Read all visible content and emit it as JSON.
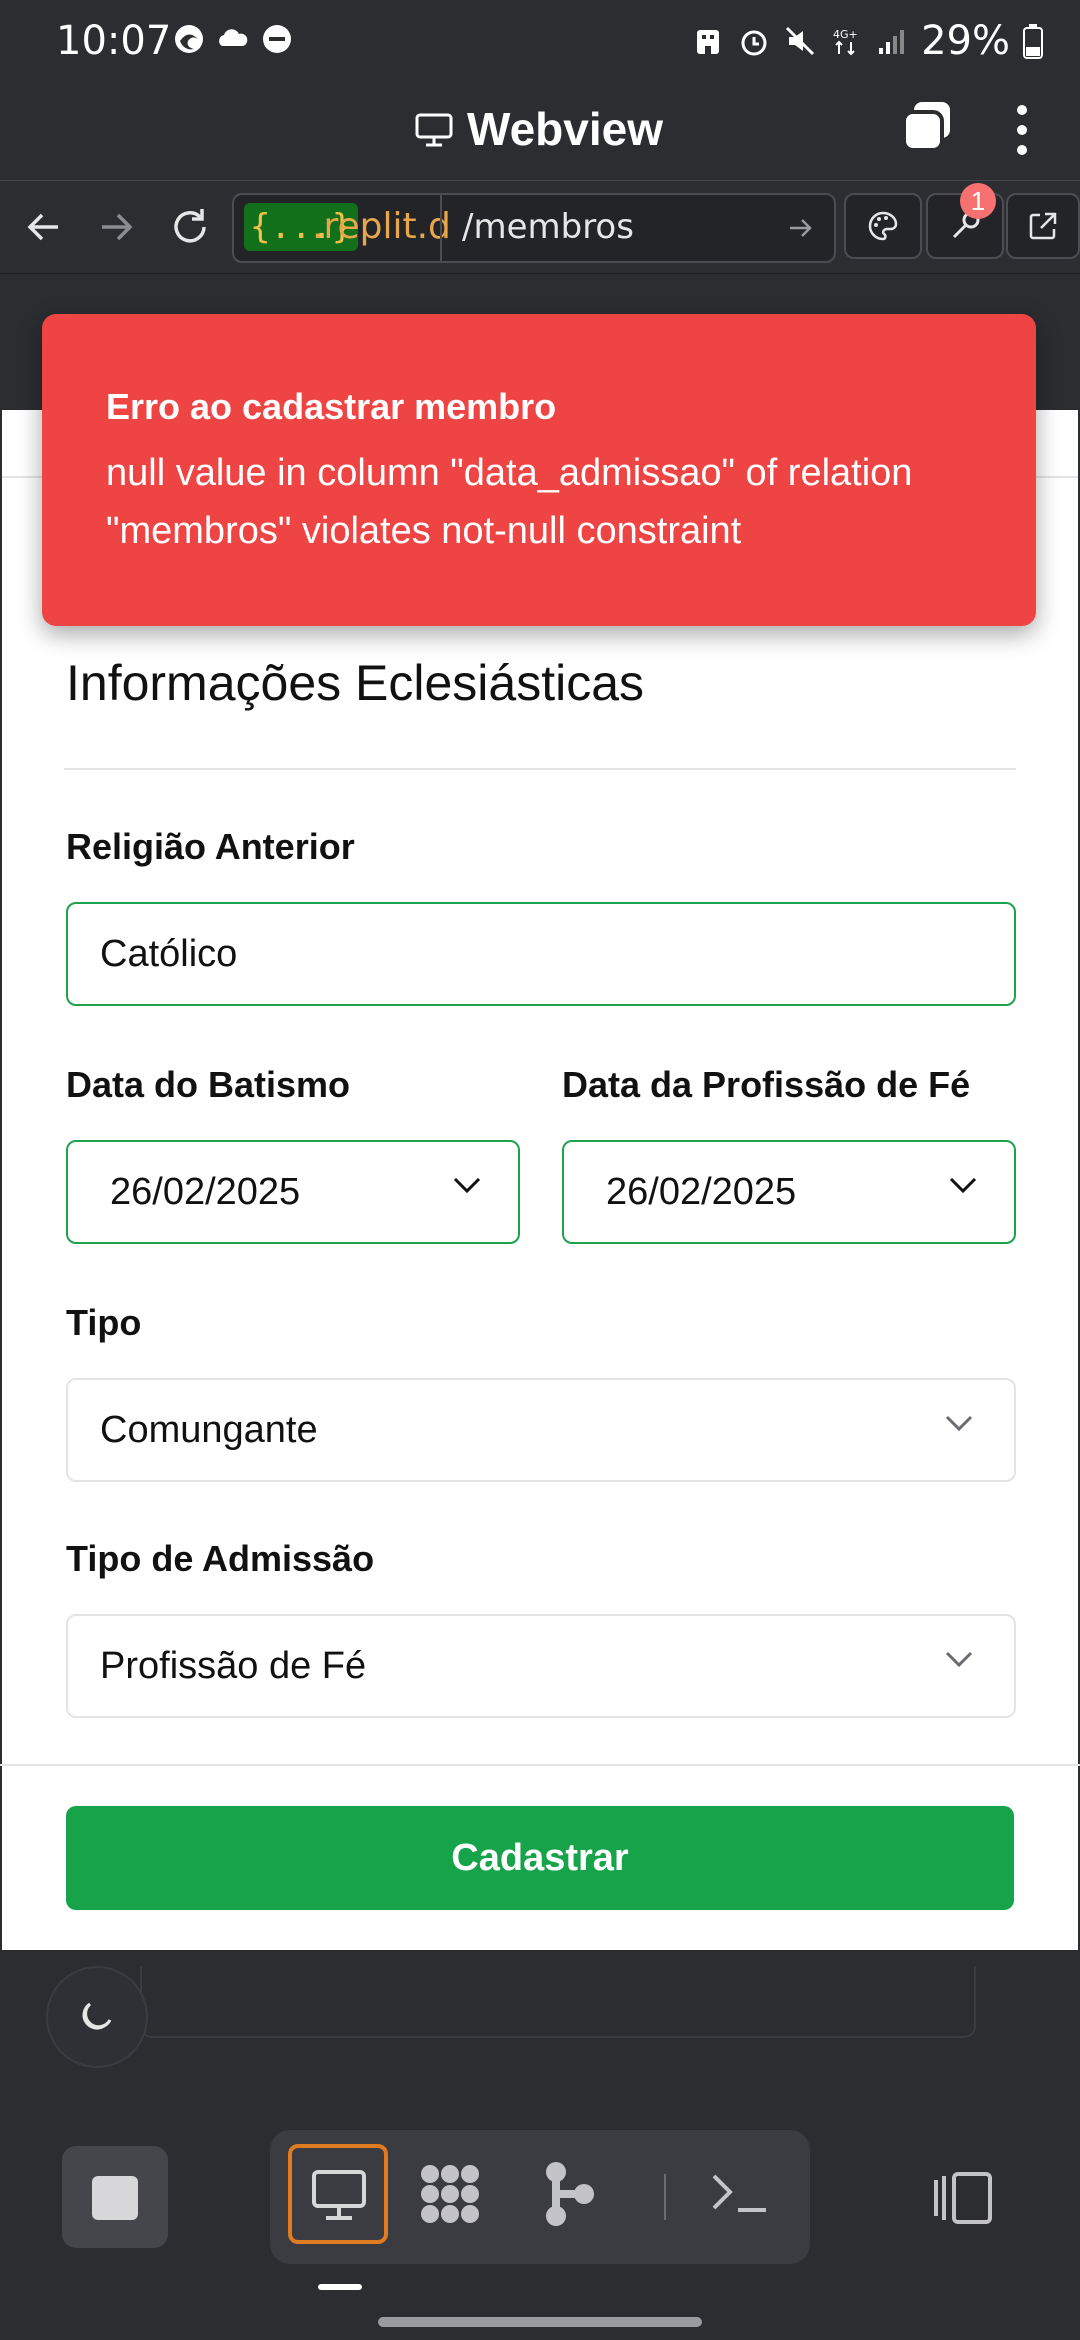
{
  "status_bar": {
    "time": "10:07",
    "battery": "29%"
  },
  "title_bar": {
    "title": "Webview"
  },
  "address_bar": {
    "badge": "{...}",
    "host": ".replit.d",
    "path": "/membros",
    "notification_count": "1"
  },
  "toast": {
    "title": "Erro ao cadastrar membro",
    "message": "null value in column \"data_admissao\" of relation \"membros\" violates not-null constraint",
    "color": "#ef4444"
  },
  "form": {
    "section_title": "Informações Eclesiásticas",
    "religiao_anterior": {
      "label": "Religião Anterior",
      "value": "Católico"
    },
    "data_batismo": {
      "label": "Data do Batismo",
      "value": "26/02/2025"
    },
    "data_profissao_fe": {
      "label": "Data da Profissão de Fé",
      "value": "26/02/2025"
    },
    "tipo": {
      "label": "Tipo",
      "value": "Comungante"
    },
    "tipo_admissao": {
      "label": "Tipo de Admissão",
      "value": "Profissão de Fé"
    },
    "submit_label": "Cadastrar",
    "accent": "#16a34a"
  },
  "bottom_toolbar": {
    "icons": [
      "stop-icon",
      "webview-icon",
      "apps-icon",
      "git-icon",
      "terminal-icon",
      "layout-icon"
    ],
    "active_color": "#e07b20"
  }
}
